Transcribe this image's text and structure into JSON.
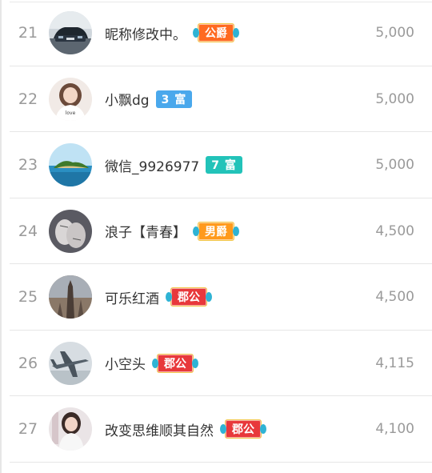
{
  "rows": [
    {
      "rank": "21",
      "name": "昵称修改中。",
      "badge": {
        "type": "noble",
        "label": "公爵",
        "color": "#ff6a21"
      },
      "amount": "5,000",
      "avatar_icon": "car-avatar-icon"
    },
    {
      "rank": "22",
      "name": "小飘dg",
      "badge": {
        "type": "rich",
        "label": "3 富",
        "color": "#4aa8ec"
      },
      "amount": "5,000",
      "avatar_icon": "girl-avatar-icon"
    },
    {
      "rank": "23",
      "name": "微信_9926977",
      "badge": {
        "type": "rich",
        "label": "7 富",
        "color": "#22c3b9"
      },
      "amount": "5,000",
      "avatar_icon": "island-avatar-icon"
    },
    {
      "rank": "24",
      "name": "浪子【青春】",
      "badge": {
        "type": "noble",
        "label": "男爵",
        "color": "#ff9a1c"
      },
      "amount": "4,500",
      "avatar_icon": "hands-avatar-icon"
    },
    {
      "rank": "25",
      "name": "可乐红酒",
      "badge": {
        "type": "noble",
        "label": "郡公",
        "color": "#e8383b"
      },
      "amount": "4,500",
      "avatar_icon": "tower-avatar-icon"
    },
    {
      "rank": "26",
      "name": "小空头",
      "badge": {
        "type": "noble",
        "label": "郡公",
        "color": "#e8383b"
      },
      "amount": "4,115",
      "avatar_icon": "plane-avatar-icon"
    },
    {
      "rank": "27",
      "name": "改变思维顺其自然",
      "badge": {
        "type": "noble",
        "label": "郡公",
        "color": "#e8383b"
      },
      "amount": "4,100",
      "avatar_icon": "woman-avatar-icon"
    }
  ]
}
